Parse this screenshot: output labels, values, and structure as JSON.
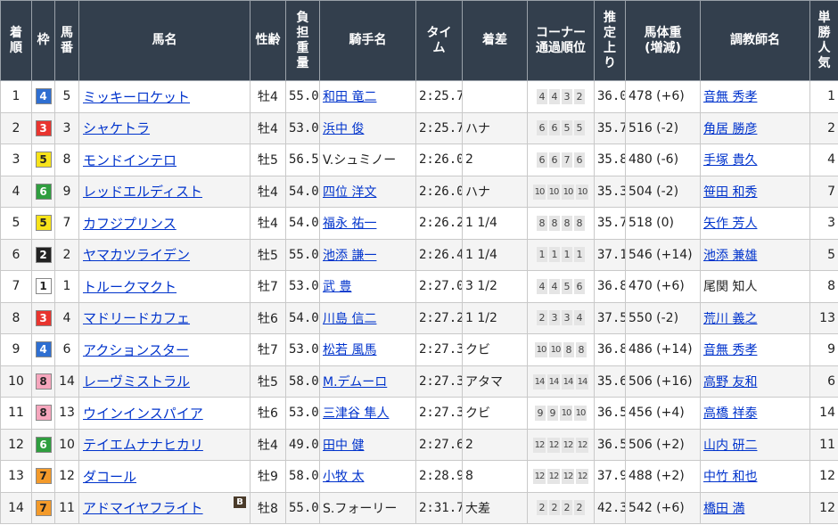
{
  "headers": {
    "finish": "着順",
    "frame": "枠",
    "number": "馬番",
    "horse": "馬名",
    "sexage": "性齢",
    "weight": "負担重量",
    "jockey": "騎手名",
    "time": "タイム",
    "margin": "着差",
    "corners": "コーナー通過順位",
    "last3f": "推定上り",
    "bodyweight": "馬体重(増減)",
    "trainer": "調教師名",
    "popularity": "単勝人気"
  },
  "frame_colors": {
    "1": {
      "bg": "#ffffff",
      "fg": "#222222"
    },
    "2": {
      "bg": "#222222",
      "fg": "#ffffff"
    },
    "3": {
      "bg": "#e8352f",
      "fg": "#ffffff"
    },
    "4": {
      "bg": "#2f6fd1",
      "fg": "#ffffff"
    },
    "5": {
      "bg": "#f7e31a",
      "fg": "#222222"
    },
    "6": {
      "bg": "#2f9e3f",
      "fg": "#ffffff"
    },
    "7": {
      "bg": "#f39a2a",
      "fg": "#222222"
    },
    "8": {
      "bg": "#f6a6bd",
      "fg": "#222222"
    }
  },
  "rows": [
    {
      "finish": "1",
      "frame": "4",
      "number": "5",
      "horse": "ミッキーロケット",
      "blinker": "",
      "sexage": "牡4",
      "weight": "55.0",
      "jockey": "和田 竜二",
      "jockey_link": true,
      "time": "2:25.7",
      "margin": "",
      "corners": [
        "4",
        "4",
        "3",
        "2"
      ],
      "last3f": "36.0",
      "bodyweight": "478 (+6)",
      "trainer": "音無 秀孝",
      "trainer_link": true,
      "popularity": "1"
    },
    {
      "finish": "2",
      "frame": "3",
      "number": "3",
      "horse": "シャケトラ",
      "blinker": "",
      "sexage": "牡4",
      "weight": "53.0",
      "jockey": "浜中 俊",
      "jockey_link": true,
      "time": "2:25.7",
      "margin": "ハナ",
      "corners": [
        "6",
        "6",
        "5",
        "5"
      ],
      "last3f": "35.7",
      "bodyweight": "516 (-2)",
      "trainer": "角居 勝彦",
      "trainer_link": true,
      "popularity": "2"
    },
    {
      "finish": "3",
      "frame": "5",
      "number": "8",
      "horse": "モンドインテロ",
      "blinker": "",
      "sexage": "牡5",
      "weight": "56.5",
      "jockey": "V.シュミノー",
      "jockey_link": false,
      "time": "2:26.0",
      "margin": "2",
      "corners": [
        "6",
        "6",
        "7",
        "6"
      ],
      "last3f": "35.8",
      "bodyweight": "480 (-6)",
      "trainer": "手塚 貴久",
      "trainer_link": true,
      "popularity": "4"
    },
    {
      "finish": "4",
      "frame": "6",
      "number": "9",
      "horse": "レッドエルディスト",
      "blinker": "",
      "sexage": "牡4",
      "weight": "54.0",
      "jockey": "四位 洋文",
      "jockey_link": true,
      "time": "2:26.0",
      "margin": "ハナ",
      "corners": [
        "10",
        "10",
        "10",
        "10"
      ],
      "last3f": "35.3",
      "bodyweight": "504 (-2)",
      "trainer": "笹田 和秀",
      "trainer_link": true,
      "popularity": "7"
    },
    {
      "finish": "5",
      "frame": "5",
      "number": "7",
      "horse": "カフジプリンス",
      "blinker": "",
      "sexage": "牡4",
      "weight": "54.0",
      "jockey": "福永 祐一",
      "jockey_link": true,
      "time": "2:26.2",
      "margin": "1 1/4",
      "corners": [
        "8",
        "8",
        "8",
        "8"
      ],
      "last3f": "35.7",
      "bodyweight": "518 (0)",
      "trainer": "矢作 芳人",
      "trainer_link": true,
      "popularity": "3"
    },
    {
      "finish": "6",
      "frame": "2",
      "number": "2",
      "horse": "ヤマカツライデン",
      "blinker": "",
      "sexage": "牡5",
      "weight": "55.0",
      "jockey": "池添 謙一",
      "jockey_link": true,
      "time": "2:26.4",
      "margin": "1 1/4",
      "corners": [
        "1",
        "1",
        "1",
        "1"
      ],
      "last3f": "37.1",
      "bodyweight": "546 (+14)",
      "trainer": "池添 兼雄",
      "trainer_link": true,
      "popularity": "5"
    },
    {
      "finish": "7",
      "frame": "1",
      "number": "1",
      "horse": "トルークマクト",
      "blinker": "",
      "sexage": "牡7",
      "weight": "53.0",
      "jockey": "武 豊",
      "jockey_link": true,
      "time": "2:27.0",
      "margin": "3 1/2",
      "corners": [
        "4",
        "4",
        "5",
        "6"
      ],
      "last3f": "36.8",
      "bodyweight": "470 (+6)",
      "trainer": "尾関 知人",
      "trainer_link": false,
      "popularity": "8"
    },
    {
      "finish": "8",
      "frame": "3",
      "number": "4",
      "horse": "マドリードカフェ",
      "blinker": "",
      "sexage": "牡6",
      "weight": "54.0",
      "jockey": "川島 信二",
      "jockey_link": true,
      "time": "2:27.2",
      "margin": "1 1/2",
      "corners": [
        "2",
        "3",
        "3",
        "4"
      ],
      "last3f": "37.5",
      "bodyweight": "550 (-2)",
      "trainer": "荒川 義之",
      "trainer_link": true,
      "popularity": "13"
    },
    {
      "finish": "9",
      "frame": "4",
      "number": "6",
      "horse": "アクションスター",
      "blinker": "",
      "sexage": "牡7",
      "weight": "53.0",
      "jockey": "松若 風馬",
      "jockey_link": true,
      "time": "2:27.3",
      "margin": "クビ",
      "corners": [
        "10",
        "10",
        "8",
        "8"
      ],
      "last3f": "36.8",
      "bodyweight": "486 (+14)",
      "trainer": "音無 秀孝",
      "trainer_link": true,
      "popularity": "9"
    },
    {
      "finish": "10",
      "frame": "8",
      "number": "14",
      "horse": "レーヴミストラル",
      "blinker": "",
      "sexage": "牡5",
      "weight": "58.0",
      "jockey": "M.デムーロ",
      "jockey_link": true,
      "time": "2:27.3",
      "margin": "アタマ",
      "corners": [
        "14",
        "14",
        "14",
        "14"
      ],
      "last3f": "35.6",
      "bodyweight": "506 (+16)",
      "trainer": "高野 友和",
      "trainer_link": true,
      "popularity": "6"
    },
    {
      "finish": "11",
      "frame": "8",
      "number": "13",
      "horse": "ウインインスパイア",
      "blinker": "",
      "sexage": "牡6",
      "weight": "53.0",
      "jockey": "三津谷 隼人",
      "jockey_link": true,
      "time": "2:27.3",
      "margin": "クビ",
      "corners": [
        "9",
        "9",
        "10",
        "10"
      ],
      "last3f": "36.5",
      "bodyweight": "456 (+4)",
      "trainer": "高橋 祥泰",
      "trainer_link": true,
      "popularity": "14"
    },
    {
      "finish": "12",
      "frame": "6",
      "number": "10",
      "horse": "テイエムナナヒカリ",
      "blinker": "",
      "sexage": "牡4",
      "weight": "49.0",
      "jockey": "田中 健",
      "jockey_link": true,
      "time": "2:27.6",
      "margin": "2",
      "corners": [
        "12",
        "12",
        "12",
        "12"
      ],
      "last3f": "36.5",
      "bodyweight": "506 (+2)",
      "trainer": "山内 研二",
      "trainer_link": true,
      "popularity": "11"
    },
    {
      "finish": "13",
      "frame": "7",
      "number": "12",
      "horse": "ダコール",
      "blinker": "",
      "sexage": "牡9",
      "weight": "58.0",
      "jockey": "小牧 太",
      "jockey_link": true,
      "time": "2:28.9",
      "margin": "8",
      "corners": [
        "12",
        "12",
        "12",
        "12"
      ],
      "last3f": "37.9",
      "bodyweight": "488 (+2)",
      "trainer": "中竹 和也",
      "trainer_link": true,
      "popularity": "12"
    },
    {
      "finish": "14",
      "frame": "7",
      "number": "11",
      "horse": "アドマイヤフライト",
      "blinker": "B",
      "sexage": "牡8",
      "weight": "55.0",
      "jockey": "S.フォーリー",
      "jockey_link": false,
      "time": "2:31.7",
      "margin": "大差",
      "corners": [
        "2",
        "2",
        "2",
        "2"
      ],
      "last3f": "42.3",
      "bodyweight": "542 (+6)",
      "trainer": "橋田 満",
      "trainer_link": true,
      "popularity": "12"
    }
  ]
}
